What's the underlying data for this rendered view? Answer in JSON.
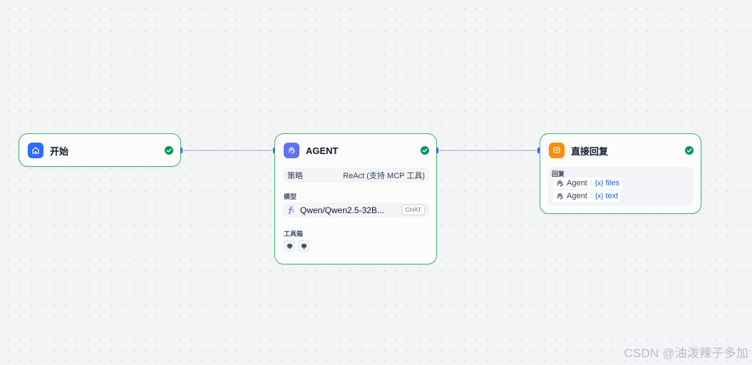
{
  "nodes": {
    "start": {
      "title": "开始",
      "status": "success"
    },
    "agent": {
      "title": "AGENT",
      "status": "success",
      "strategy_label": "策略",
      "strategy_value": "ReAct (支持 MCP 工具)",
      "model_label": "模型",
      "model_name": "Qwen/Qwen2.5-32B...",
      "model_type": "CHAT",
      "toolbox_label": "工具箱",
      "tools": [
        "tool-icon",
        "tool-icon"
      ]
    },
    "reply": {
      "title": "直接回复",
      "status": "success",
      "reply_label": "回复",
      "variables": [
        {
          "source": "Agent",
          "separator": "/",
          "code": "{x}",
          "name": "files"
        },
        {
          "source": "Agent",
          "separator": "/",
          "code": "{x}",
          "name": "text"
        }
      ]
    }
  },
  "colors": {
    "node_border": "#3fb56b",
    "start_icon_bg": "#2e6bff",
    "agent_icon_bg": "#6172f3",
    "reply_icon_bg": "#f79009",
    "edge": "#c8cdd6",
    "handle": "#2e6bff",
    "status_success": "#079455"
  },
  "watermark": "CSDN @油泼辣子多加"
}
